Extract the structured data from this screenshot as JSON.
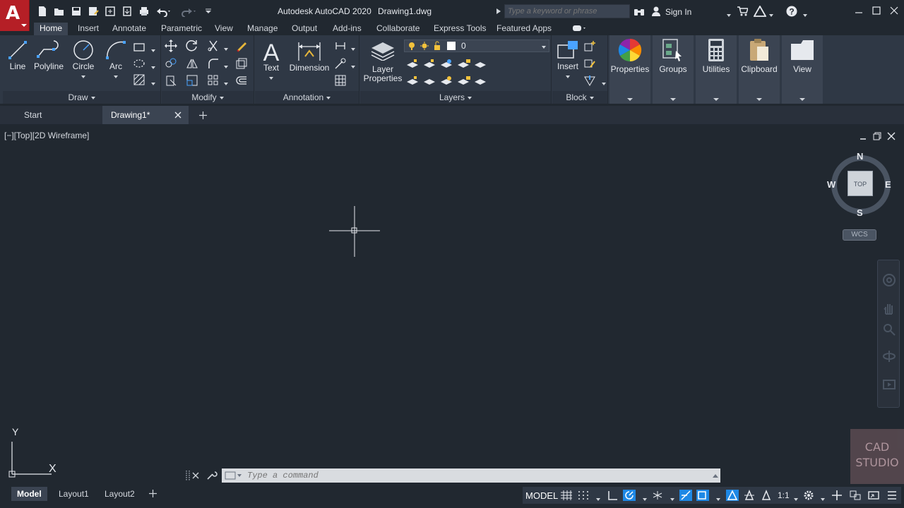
{
  "app": {
    "title": "Autodesk AutoCAD 2020",
    "file_title": "Drawing1.dwg",
    "logo_letter": "A"
  },
  "search": {
    "placeholder": "Type a keyword or phrase"
  },
  "account": {
    "sign_in": "Sign In"
  },
  "ribbon_tabs": [
    "Home",
    "Insert",
    "Annotate",
    "Parametric",
    "View",
    "Manage",
    "Output",
    "Add-ins",
    "Collaborate",
    "Express Tools",
    "Featured Apps"
  ],
  "ribbon": {
    "draw": {
      "title": "Draw",
      "line": "Line",
      "polyline": "Polyline",
      "circle": "Circle",
      "arc": "Arc"
    },
    "modify": {
      "title": "Modify"
    },
    "annotation": {
      "title": "Annotation",
      "text": "Text",
      "dimension": "Dimension"
    },
    "layers": {
      "title": "Layers",
      "layer_properties_1": "Layer",
      "layer_properties_2": "Properties",
      "current_layer": "0"
    },
    "block": {
      "title": "Block",
      "insert": "Insert"
    },
    "properties": "Properties",
    "groups": "Groups",
    "utilities": "Utilities",
    "clipboard": "Clipboard",
    "view": "View"
  },
  "file_tabs": {
    "start": "Start",
    "drawing": "Drawing1*"
  },
  "viewport": {
    "label": "[−][Top][2D Wireframe]"
  },
  "viewcube": {
    "north": "N",
    "south": "S",
    "east": "E",
    "west": "W",
    "top": "TOP",
    "wcs": "WCS"
  },
  "ucs": {
    "x": "X",
    "y": "Y"
  },
  "command": {
    "placeholder": "Type a command"
  },
  "layout_tabs": {
    "model": "Model",
    "layout1": "Layout1",
    "layout2": "Layout2"
  },
  "status": {
    "model": "MODEL",
    "scale": "1:1"
  },
  "watermark": {
    "line1": "CAD",
    "line2": "STUDIO"
  },
  "colors": {
    "accent": "#1e88e5",
    "logo": "#b51f26",
    "background": "#212830",
    "ribbon": "#2f3845"
  }
}
